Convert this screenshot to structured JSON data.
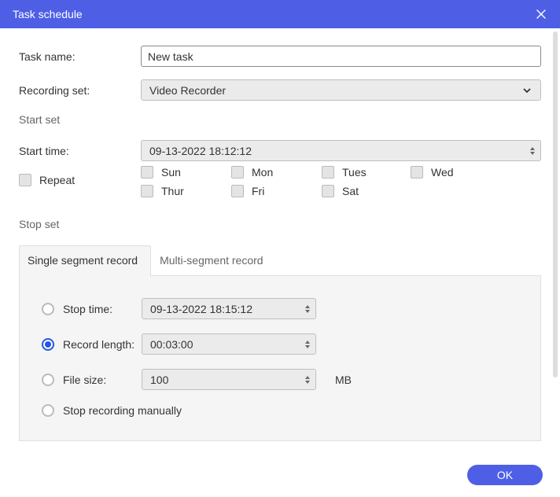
{
  "titleBar": {
    "title": "Task schedule"
  },
  "fields": {
    "taskNameLabel": "Task name:",
    "taskNameValue": "New task",
    "recordingSetLabel": "Recording set:",
    "recordingSetValue": "Video Recorder"
  },
  "startSet": {
    "heading": "Start set",
    "startTimeLabel": "Start time:",
    "startTimeValue": "09-13-2022 18:12:12",
    "repeatLabel": "Repeat",
    "days": {
      "sun": "Sun",
      "mon": "Mon",
      "tues": "Tues",
      "wed": "Wed",
      "thur": "Thur",
      "fri": "Fri",
      "sat": "Sat"
    }
  },
  "stopSet": {
    "heading": "Stop set",
    "tabs": {
      "single": "Single segment record",
      "multi": "Multi-segment record"
    },
    "stopTime": {
      "label": "Stop time:",
      "value": "09-13-2022 18:15:12"
    },
    "recordLength": {
      "label": "Record length:",
      "value": "00:03:00"
    },
    "fileSize": {
      "label": "File size:",
      "value": "100",
      "unit": "MB"
    },
    "manual": {
      "label": "Stop recording manually"
    }
  },
  "footer": {
    "ok": "OK"
  }
}
